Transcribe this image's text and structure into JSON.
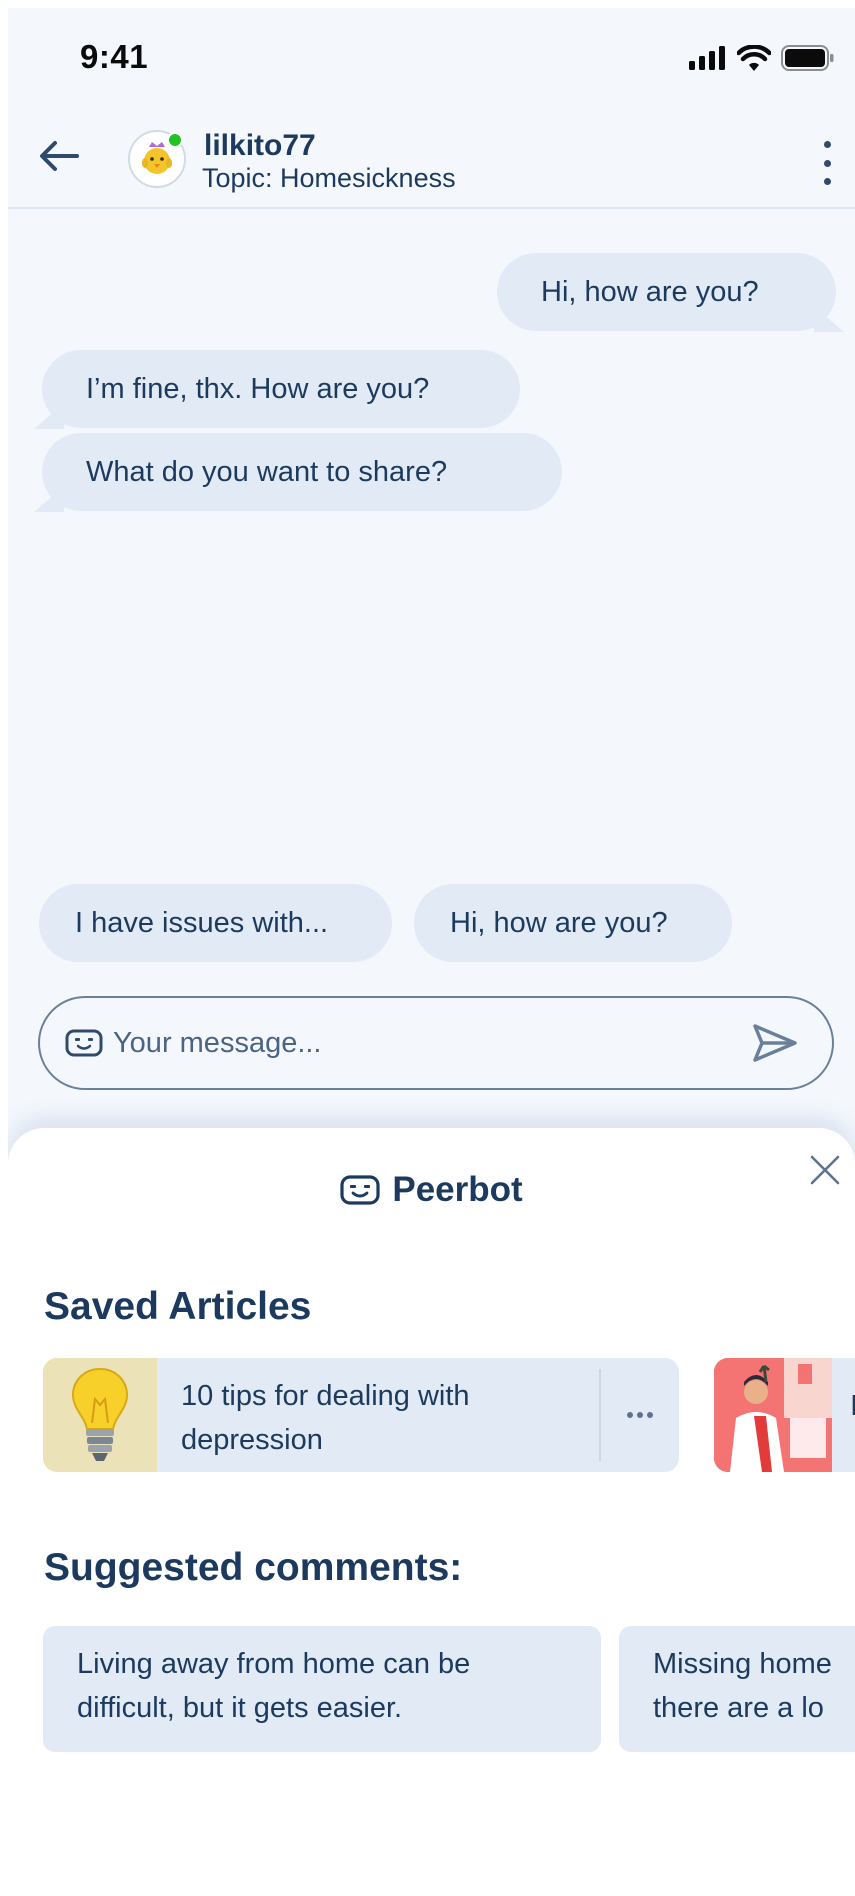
{
  "status_bar": {
    "time": "9:41"
  },
  "header": {
    "username": "lilkito77",
    "topic": "Topic: Homesickness"
  },
  "messages": [
    {
      "direction": "out",
      "text": "Hi, how are you?"
    },
    {
      "direction": "in",
      "text": "I’m fine, thx. How are you?"
    },
    {
      "direction": "in",
      "text": "What do you want to share?"
    }
  ],
  "quick_replies": [
    "I have issues with...",
    "Hi, how are you?"
  ],
  "composer": {
    "placeholder": "Your message..."
  },
  "peerbot": {
    "title": "Peerbot",
    "saved_articles_title": "Saved Articles",
    "articles": [
      {
        "title": "10 tips for dealing with depression"
      },
      {
        "title": "I"
      }
    ],
    "suggested_comments_title": "Suggested comments:",
    "comments": [
      {
        "text": "Living away from home can be difficult, but it gets easier."
      },
      {
        "text": "Missing home there are a lo"
      }
    ]
  },
  "colors": {
    "background": "#f4f8fd",
    "bubble": "#e1eaf5",
    "text_primary": "#1c3a5e",
    "online": "#22c222"
  }
}
